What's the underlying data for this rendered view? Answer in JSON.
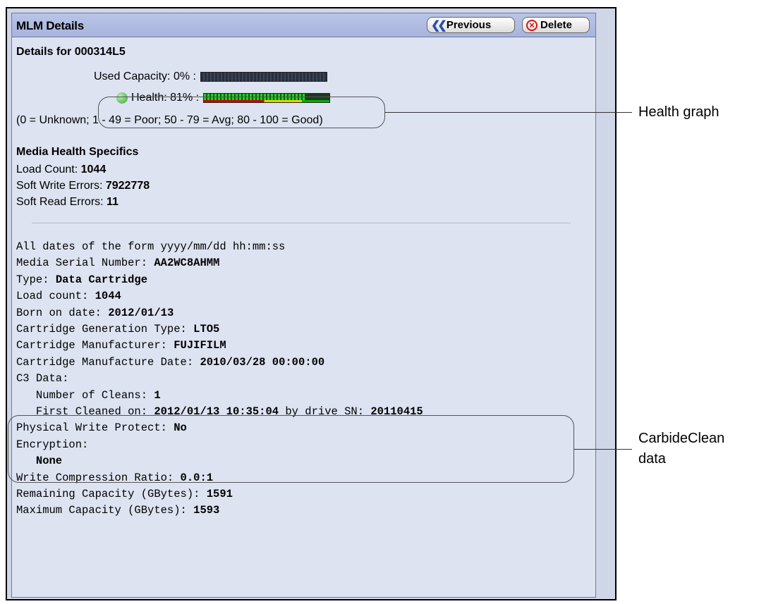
{
  "panel": {
    "title": "MLM Details",
    "buttons": {
      "previous": "Previous",
      "delete": "Delete"
    },
    "details_heading": "Details for 000314L5",
    "used_capacity": {
      "label": "Used Capacity: 0% :",
      "percent": 0
    },
    "health": {
      "label": "Health: 81% :",
      "percent": 81,
      "status_icon": "check-circle-icon"
    },
    "legend": "(0 = Unknown; 1 - 49 = Poor; 50 - 79 = Avg; 80 - 100 = Good)",
    "media_health": {
      "title": "Media Health Specifics",
      "items": [
        {
          "label": "Load Count: ",
          "value": "1044"
        },
        {
          "label": "Soft Write Errors: ",
          "value": "7922778"
        },
        {
          "label": "Soft Read Errors: ",
          "value": "11"
        }
      ]
    },
    "info_lines": [
      {
        "label": "All dates of the form yyyy/mm/dd hh:mm:ss",
        "value": ""
      },
      {
        "label": "Media Serial Number: ",
        "value": "AA2WC8AHMM"
      },
      {
        "label": "Type: ",
        "value": "Data Cartridge"
      },
      {
        "label": "Load count: ",
        "value": "1044"
      },
      {
        "label": "Born on date: ",
        "value": "2012/01/13"
      },
      {
        "label": "Cartridge Generation Type: ",
        "value": "LTO5"
      },
      {
        "label": "Cartridge Manufacturer: ",
        "value": "FUJIFILM"
      },
      {
        "label": "Cartridge Manufacture Date: ",
        "value": "2010/03/28 00:00:00"
      },
      {
        "label": "C3 Data:",
        "value": ""
      },
      {
        "label": "   Number of Cleans: ",
        "value": "1"
      },
      {
        "label": "   First Cleaned on: ",
        "value": "2012/01/13 10:35:04",
        "label2": " by drive SN: ",
        "value2": "20110415"
      },
      {
        "label": "Physical Write Protect: ",
        "value": "No"
      },
      {
        "label": "Encryption:",
        "value": ""
      },
      {
        "label": "   ",
        "value": "None"
      },
      {
        "label": "Write Compression Ratio: ",
        "value": "0.0:1"
      },
      {
        "label": "Remaining Capacity (GBytes): ",
        "value": "1591"
      },
      {
        "label": "Maximum Capacity (GBytes): ",
        "value": "1593"
      }
    ]
  },
  "callouts": {
    "health_graph": "Health graph",
    "carbideclean_line1": "CarbideClean",
    "carbideclean_line2": "data"
  },
  "colors": {
    "title_bar": "#a8b4dd",
    "panel_bg": "#dde3f1",
    "bar_green": "#1bd51b",
    "strip_red": "#d20000",
    "strip_yellow": "#e6d200",
    "strip_green": "#00b000"
  }
}
